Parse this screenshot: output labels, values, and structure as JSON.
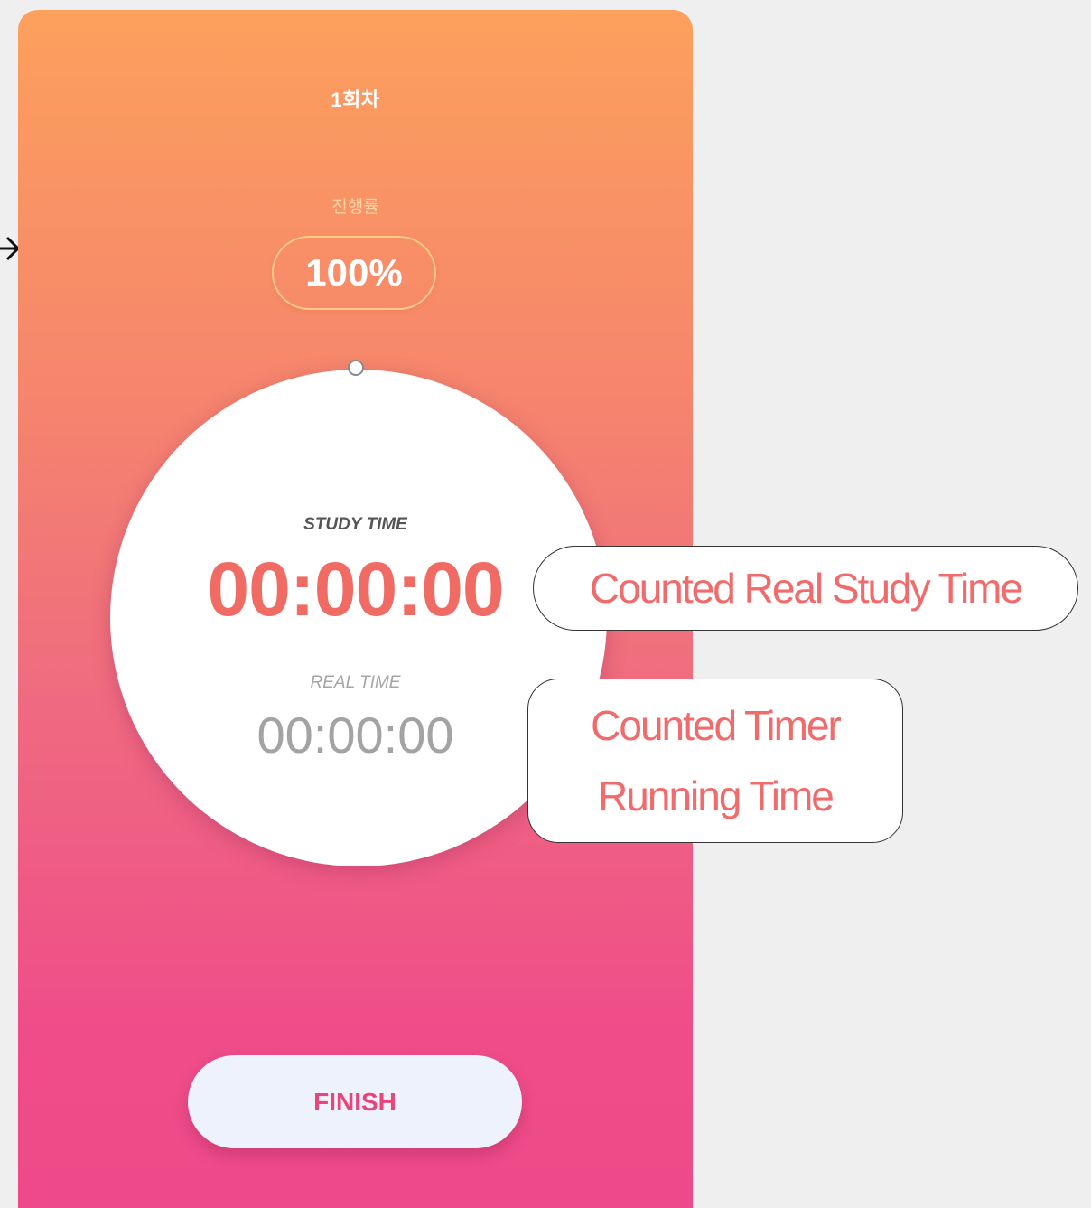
{
  "app": {
    "session_title": "1회차",
    "progress_label": "진행률",
    "progress_value": "100%",
    "progress_fraction": 1.0,
    "study_time_label": "STUDY TIME",
    "study_time_value": "00:00:00",
    "real_time_label": "REAL TIME",
    "real_time_value": "00:00:00",
    "finish_label": "FINISH"
  },
  "annotations": {
    "study_callout": "Counted Real Study Time",
    "real_callout_line1": "Counted Timer",
    "real_callout_line2": "Running Time"
  },
  "colors": {
    "gradient_top": "#fda05c",
    "gradient_bottom": "#ee4a89",
    "study_time": "#f06b63",
    "finish_text": "#e8457a",
    "callout_text": "#f06b6b"
  },
  "icons": {
    "left_arrow": "arrow-right-icon"
  }
}
